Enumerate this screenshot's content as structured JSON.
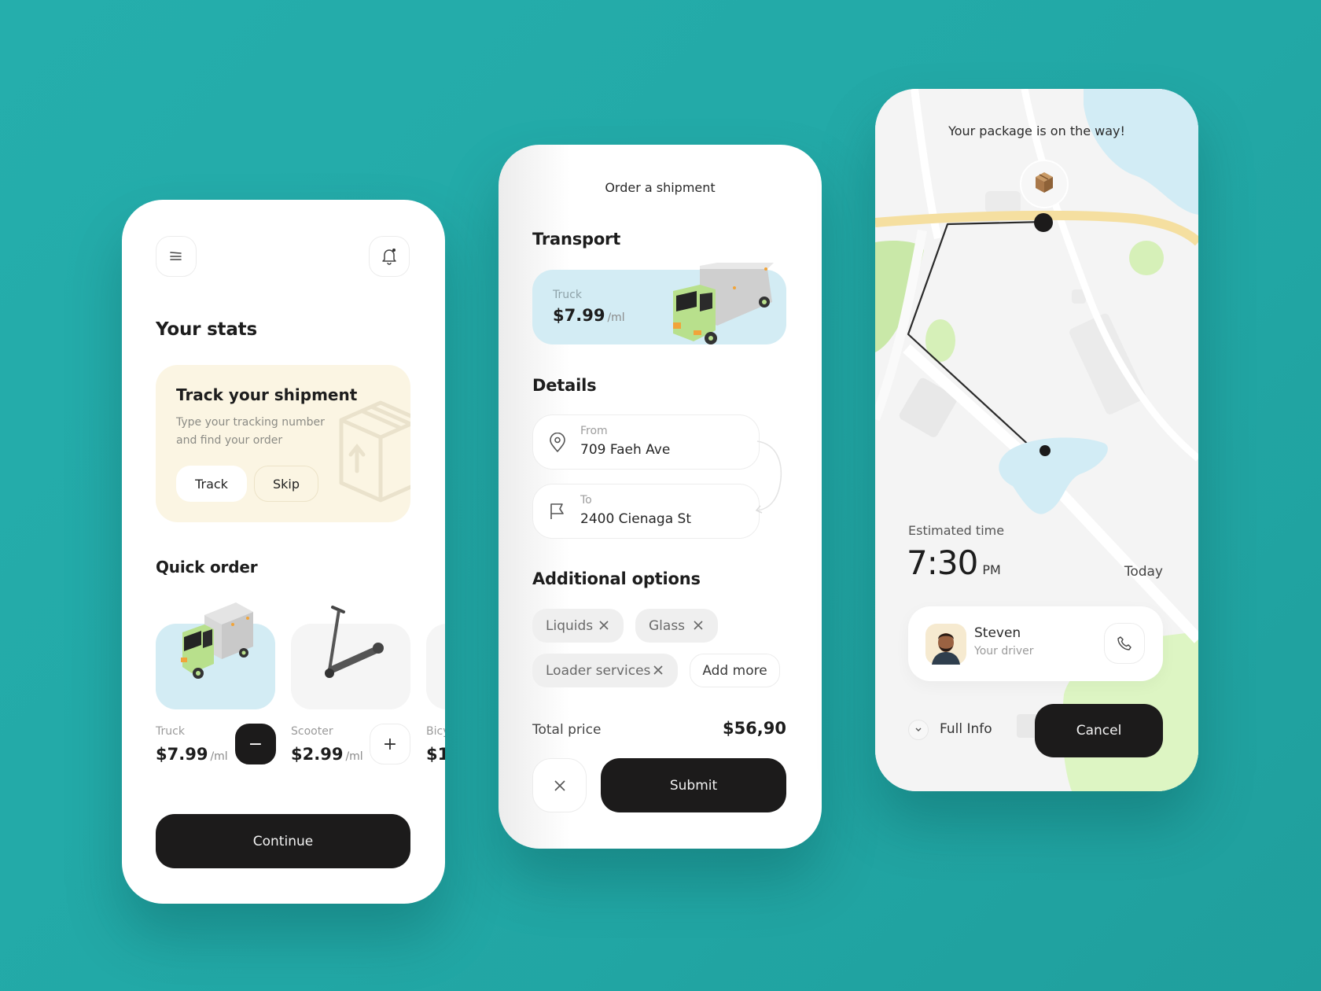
{
  "colors": {
    "background": "#23aaa8",
    "dark_button": "#1c1b1b",
    "track_card": "#fbf5e3",
    "truck_tile": "#d3ecf4",
    "scooter_tile": "#f5f5f5",
    "map_road": "#f5dfa0",
    "map_water": "#d2ecf5",
    "map_park": "#d6f0b8"
  },
  "stats_screen": {
    "menu_icon": "menu-icon",
    "notification_icon": "bell-icon",
    "title": "Your stats",
    "track_card": {
      "title": "Track your shipment",
      "description": "Type your tracking number and find your order",
      "track_button": "Track",
      "skip_button": "Skip",
      "illustration": "package-box-icon"
    },
    "quick_order": {
      "title": "Quick order",
      "items": [
        {
          "name": "Truck",
          "price": "$7.99",
          "unit": "/ml",
          "action": "−",
          "selected": true
        },
        {
          "name": "Scooter",
          "price": "$2.99",
          "unit": "/ml",
          "action": "+",
          "selected": false
        },
        {
          "name": "Bicy",
          "price": "$1.",
          "unit": "",
          "action": "",
          "selected": false
        }
      ]
    },
    "continue_button": "Continue"
  },
  "order_screen": {
    "title": "Order a shipment",
    "transport": {
      "heading": "Transport",
      "vehicle": "Truck",
      "price": "$7.99",
      "unit": "/ml"
    },
    "details": {
      "heading": "Details",
      "from_label": "From",
      "from_value": "709 Faeh Ave",
      "to_label": "To",
      "to_value": "2400 Cienaga St"
    },
    "additional_options": {
      "heading": "Additional options",
      "chips": [
        "Liquids",
        "Glass",
        "Loader services"
      ],
      "add_more": "Add more"
    },
    "total_label": "Total price",
    "total_value": "$56,90",
    "submit_button": "Submit"
  },
  "tracking_screen": {
    "title": "Your package is on the way!",
    "estimated_label": "Estimated time",
    "estimated_time": "7:30",
    "estimated_period": "PM",
    "estimated_day": "Today",
    "driver": {
      "name": "Steven",
      "role": "Your driver"
    },
    "full_info": "Full Info",
    "cancel_button": "Cancel"
  }
}
